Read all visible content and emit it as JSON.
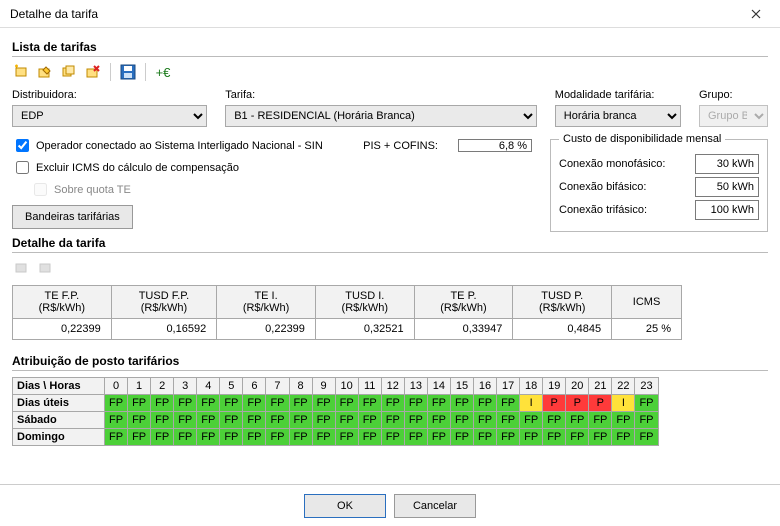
{
  "window": {
    "title": "Detalhe da tarifa"
  },
  "sections": {
    "lista": "Lista de tarifas",
    "detalhe": "Detalhe da tarifa",
    "posto": "Atribuição de posto tarifários"
  },
  "labels": {
    "distribuidora": "Distribuidora:",
    "tarifa": "Tarifa:",
    "modalidade": "Modalidade tarifária:",
    "grupo": "Grupo:",
    "pis_cofins": "PIS + COFINS:",
    "bandeiras": "Bandeiras tarifárias",
    "dias_horas": "Dias \\ Horas"
  },
  "selects": {
    "distribuidora": "EDP",
    "tarifa": "B1 - RESIDENCIAL (Horária Branca)",
    "modalidade": "Horária branca",
    "grupo": "Grupo B"
  },
  "checks": {
    "sin": "Operador conectado ao Sistema Interligado Nacional - SIN",
    "icms": "Excluir ICMS do cálculo de compensação",
    "sobre": "Sobre quota TE"
  },
  "pis_cofins_value": "6,8 %",
  "custo": {
    "legend": "Custo de disponibilidade mensal",
    "mono_label": "Conexão monofásico:",
    "mono_value": "30 kWh",
    "bi_label": "Conexão bifásico:",
    "bi_value": "50 kWh",
    "tri_label": "Conexão trifásico:",
    "tri_value": "100 kWh"
  },
  "tarifa_headers": [
    "TE F.P. (R$/kWh)",
    "TUSD F.P. (R$/kWh)",
    "TE I. (R$/kWh)",
    "TUSD I. (R$/kWh)",
    "TE P. (R$/kWh)",
    "TUSD P. (R$/kWh)",
    "ICMS"
  ],
  "tarifa_row": [
    "0,22399",
    "0,16592",
    "0,22399",
    "0,32521",
    "0,33947",
    "0,4845",
    "25 %"
  ],
  "posto": {
    "hours": [
      "0",
      "1",
      "2",
      "3",
      "4",
      "5",
      "6",
      "7",
      "8",
      "9",
      "10",
      "11",
      "12",
      "13",
      "14",
      "15",
      "16",
      "17",
      "18",
      "19",
      "20",
      "21",
      "22",
      "23"
    ],
    "rows": [
      {
        "label": "Dias úteis",
        "cells": [
          "FP",
          "FP",
          "FP",
          "FP",
          "FP",
          "FP",
          "FP",
          "FP",
          "FP",
          "FP",
          "FP",
          "FP",
          "FP",
          "FP",
          "FP",
          "FP",
          "FP",
          "FP",
          "I",
          "P",
          "P",
          "P",
          "I",
          "FP"
        ]
      },
      {
        "label": "Sábado",
        "cells": [
          "FP",
          "FP",
          "FP",
          "FP",
          "FP",
          "FP",
          "FP",
          "FP",
          "FP",
          "FP",
          "FP",
          "FP",
          "FP",
          "FP",
          "FP",
          "FP",
          "FP",
          "FP",
          "FP",
          "FP",
          "FP",
          "FP",
          "FP",
          "FP"
        ]
      },
      {
        "label": "Domingo",
        "cells": [
          "FP",
          "FP",
          "FP",
          "FP",
          "FP",
          "FP",
          "FP",
          "FP",
          "FP",
          "FP",
          "FP",
          "FP",
          "FP",
          "FP",
          "FP",
          "FP",
          "FP",
          "FP",
          "FP",
          "FP",
          "FP",
          "FP",
          "FP",
          "FP"
        ]
      }
    ]
  },
  "footer": {
    "ok": "OK",
    "cancel": "Cancelar"
  }
}
